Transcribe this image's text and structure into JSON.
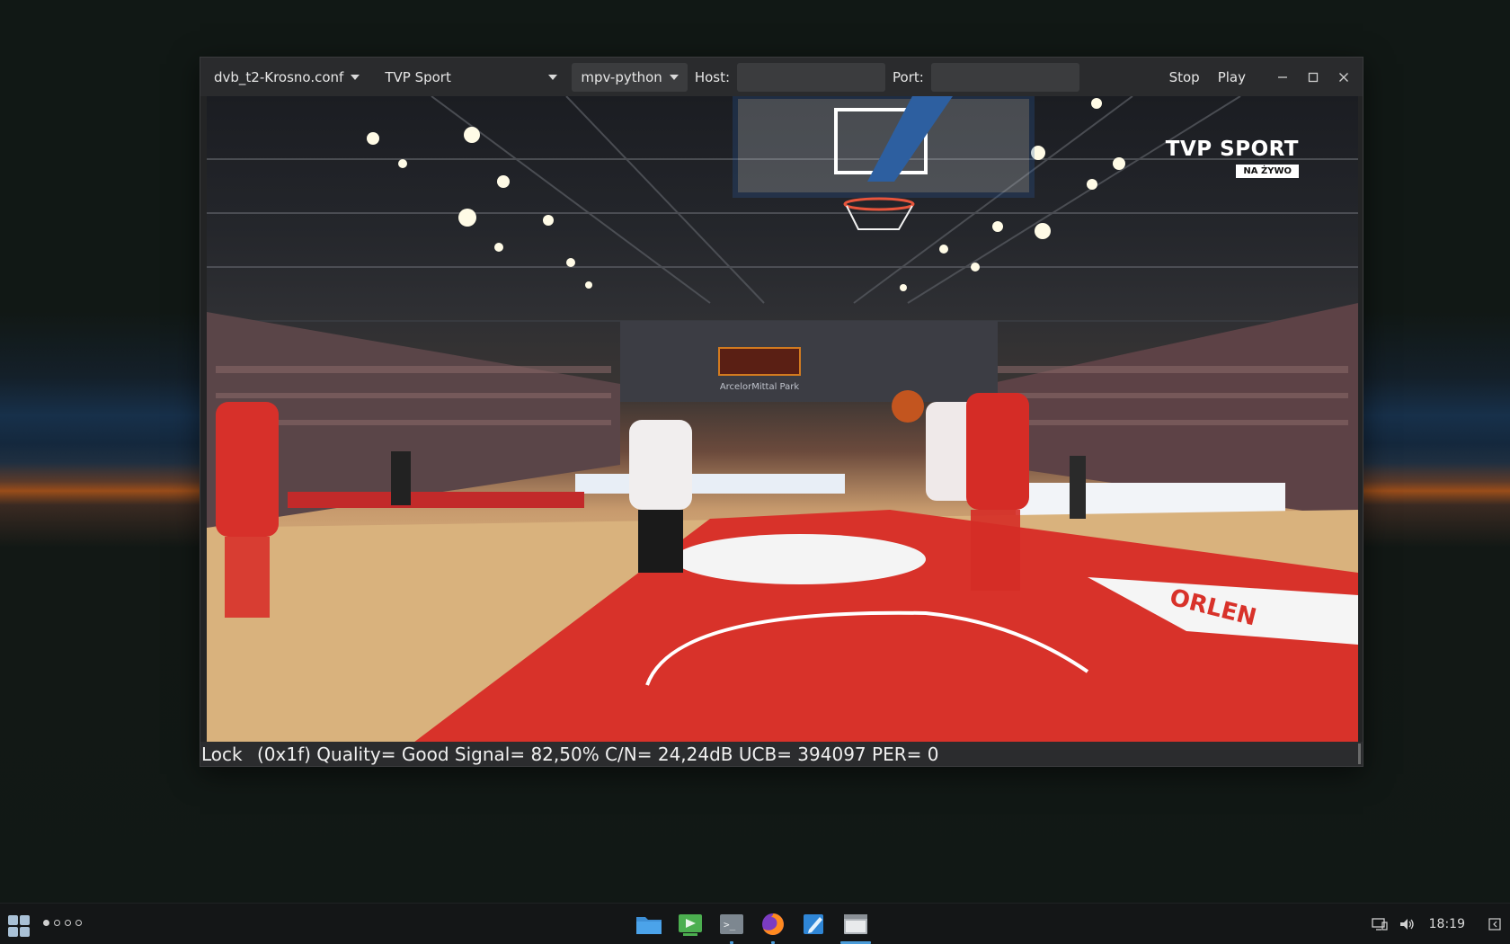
{
  "toolbar": {
    "config_file": "dvb_t2-Krosno.conf",
    "channel": "TVP Sport",
    "player": "mpv-python",
    "host_label": "Host:",
    "host_value": "",
    "port_label": "Port:",
    "port_value": "",
    "stop_label": "Stop",
    "play_label": "Play"
  },
  "video": {
    "overlay_logo": "TVP SPORT",
    "overlay_badge": "NA ŻYWO",
    "arena_sign": "ArcelorMittal Park",
    "floor_logo": "ORLEN"
  },
  "status": {
    "lock": "Lock",
    "details": "(0x1f) Quality= Good Signal= 82,50% C/N= 24,24dB UCB= 394097 PER= 0"
  },
  "taskbar": {
    "workspaces": 4,
    "active_workspace": 1,
    "apps": [
      "file-manager",
      "screenshot-tool",
      "terminal",
      "firefox",
      "text-editor",
      "tv-player-window"
    ],
    "clock": "18:19"
  },
  "colors": {
    "window_bg": "#2a2b2d",
    "accent": "#4a9bd8",
    "court_red": "#d8322a"
  }
}
